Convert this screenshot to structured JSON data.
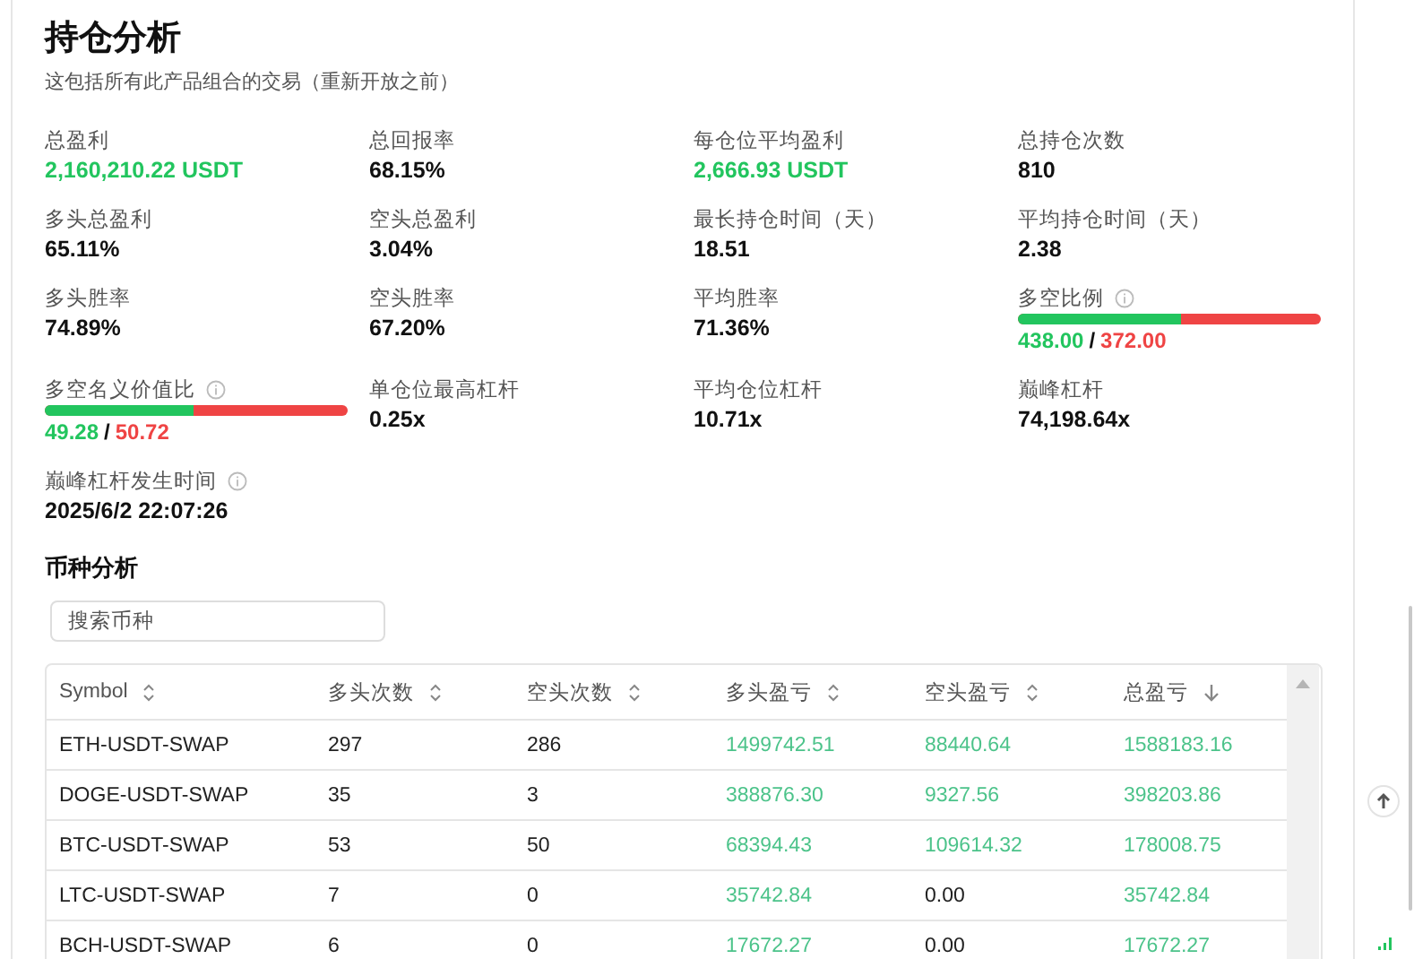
{
  "header": {
    "title": "持仓分析",
    "subtitle": "这包括所有此产品组合的交易（重新开放之前）"
  },
  "metrics": [
    {
      "kind": "value",
      "label": "总盈利",
      "value": "2,160,210.22 USDT",
      "positive": true
    },
    {
      "kind": "value",
      "label": "总回报率",
      "value": "68.15%",
      "positive": false
    },
    {
      "kind": "value",
      "label": "每仓位平均盈利",
      "value": "2,666.93 USDT",
      "positive": true
    },
    {
      "kind": "value",
      "label": "总持仓次数",
      "value": "810",
      "positive": false
    },
    {
      "kind": "value",
      "label": "多头总盈利",
      "value": "65.11%",
      "positive": false
    },
    {
      "kind": "value",
      "label": "空头总盈利",
      "value": "3.04%",
      "positive": false
    },
    {
      "kind": "value",
      "label": "最长持仓时间（天）",
      "value": "18.51",
      "positive": false
    },
    {
      "kind": "value",
      "label": "平均持仓时间（天）",
      "value": "2.38",
      "positive": false
    },
    {
      "kind": "value",
      "label": "多头胜率",
      "value": "74.89%",
      "positive": false
    },
    {
      "kind": "value",
      "label": "空头胜率",
      "value": "67.20%",
      "positive": false
    },
    {
      "kind": "value",
      "label": "平均胜率",
      "value": "71.36%",
      "positive": false
    },
    {
      "kind": "ratio",
      "label": "多空比例",
      "info": true,
      "level": 0.54,
      "long": "438.00",
      "separator": "/",
      "short": "372.00"
    },
    {
      "kind": "ratio",
      "label": "多空名义价值比",
      "info": true,
      "level": 0.4928,
      "long": "49.28",
      "separator": "/",
      "short": "50.72"
    },
    {
      "kind": "value",
      "label": "单仓位最高杠杆",
      "value": "0.25x",
      "positive": false
    },
    {
      "kind": "value",
      "label": "平均仓位杠杆",
      "value": "10.71x",
      "positive": false
    },
    {
      "kind": "value",
      "label": "巅峰杠杆",
      "value": "74,198.64x",
      "positive": false
    },
    {
      "kind": "value",
      "label": "巅峰杠杆发生时间",
      "info": true,
      "value": "2025/6/2 22:07:26",
      "positive": false
    }
  ],
  "symbols": {
    "title": "币种分析",
    "search": {
      "placeholder": "搜索币种"
    },
    "columns": [
      {
        "label": "Symbol",
        "sorted": false
      },
      {
        "label": "多头次数",
        "sorted": false
      },
      {
        "label": "空头次数",
        "sorted": false
      },
      {
        "label": "多头盈亏",
        "sorted": false
      },
      {
        "label": "空头盈亏",
        "sorted": false
      },
      {
        "label": "总盈亏",
        "sorted": true
      }
    ],
    "rows": [
      {
        "symbol": "ETH-USDT-SWAP",
        "long_count": "297",
        "short_count": "286",
        "long_pnl": {
          "text": "1499742.51",
          "positive": true
        },
        "short_pnl": {
          "text": "88440.64",
          "positive": true
        },
        "total_pnl": {
          "text": "1588183.16",
          "positive": true
        }
      },
      {
        "symbol": "DOGE-USDT-SWAP",
        "long_count": "35",
        "short_count": "3",
        "long_pnl": {
          "text": "388876.30",
          "positive": true
        },
        "short_pnl": {
          "text": "9327.56",
          "positive": true
        },
        "total_pnl": {
          "text": "398203.86",
          "positive": true
        }
      },
      {
        "symbol": "BTC-USDT-SWAP",
        "long_count": "53",
        "short_count": "50",
        "long_pnl": {
          "text": "68394.43",
          "positive": true
        },
        "short_pnl": {
          "text": "109614.32",
          "positive": true
        },
        "total_pnl": {
          "text": "178008.75",
          "positive": true
        }
      },
      {
        "symbol": "LTC-USDT-SWAP",
        "long_count": "7",
        "short_count": "0",
        "long_pnl": {
          "text": "35742.84",
          "positive": true
        },
        "short_pnl": {
          "text": "0.00",
          "positive": false
        },
        "total_pnl": {
          "text": "35742.84",
          "positive": true
        }
      },
      {
        "symbol": "BCH-USDT-SWAP",
        "long_count": "6",
        "short_count": "0",
        "long_pnl": {
          "text": "17672.27",
          "positive": true
        },
        "short_pnl": {
          "text": "0.00",
          "positive": false
        },
        "total_pnl": {
          "text": "17672.27",
          "positive": true
        }
      }
    ]
  }
}
